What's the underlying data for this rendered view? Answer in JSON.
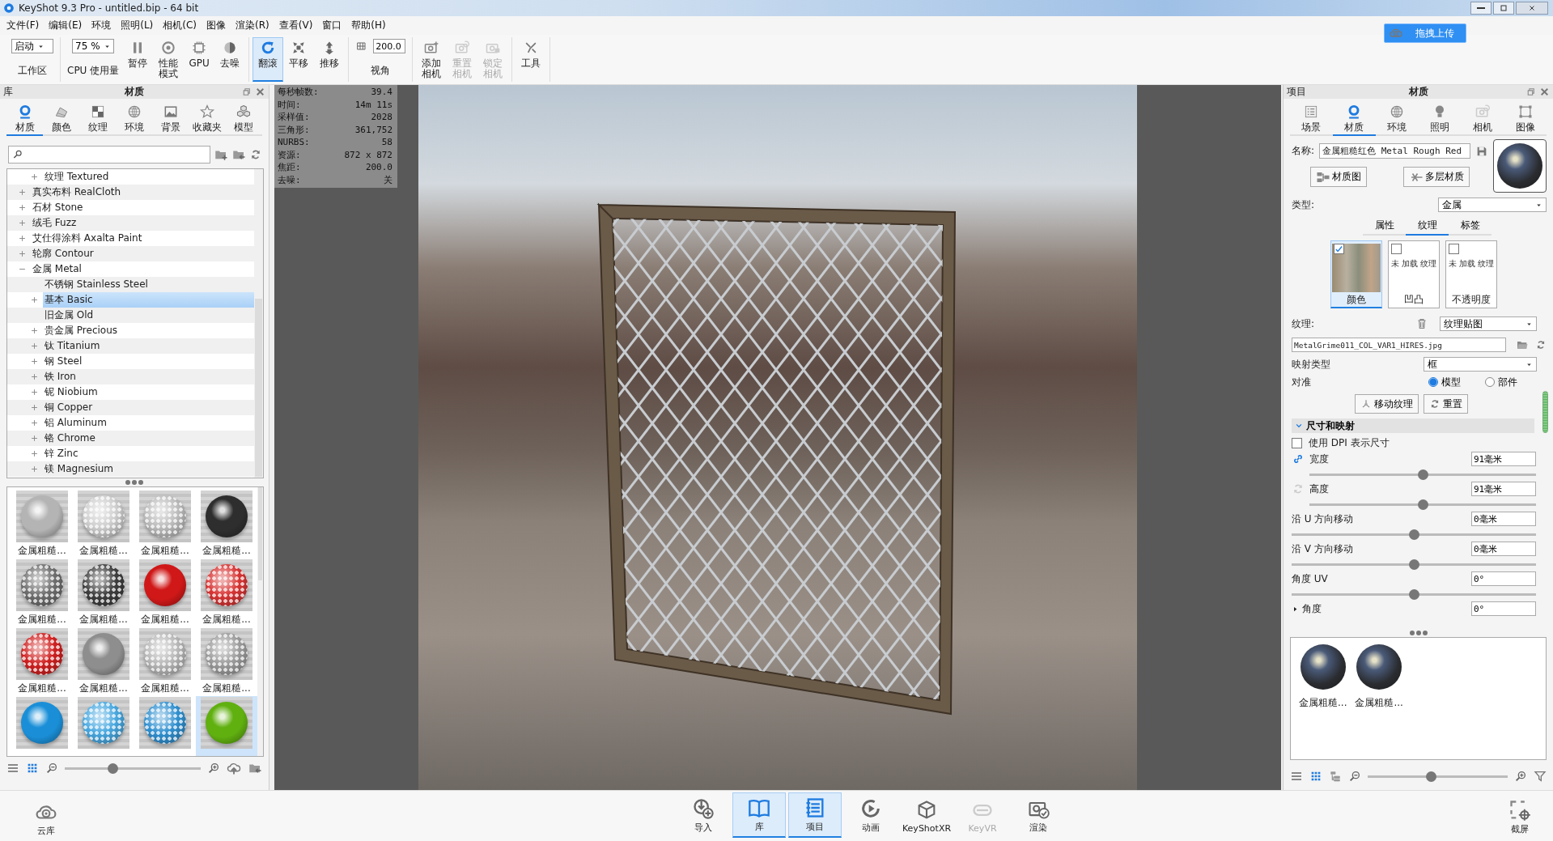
{
  "window": {
    "title": "KeyShot 9.3 Pro  - untitled.bip  - 64 bit"
  },
  "upload_button": "拖拽上传",
  "menu": [
    "文件(F)",
    "编辑(E)",
    "环境",
    "照明(L)",
    "相机(C)",
    "图像",
    "渲染(R)",
    "查看(V)",
    "窗口",
    "帮助(H)"
  ],
  "toolbar": [
    {
      "kind": "dropdown",
      "value": "启动",
      "label": "工作区"
    },
    {
      "kind": "dropdown",
      "value": "75 %",
      "label": "CPU 使用量"
    },
    {
      "kind": "button",
      "lines": [
        "暂停"
      ],
      "selected": false,
      "disabled": false
    },
    {
      "kind": "button",
      "lines": [
        "性能",
        "模式"
      ],
      "selected": false,
      "disabled": false
    },
    {
      "kind": "button",
      "lines": [
        "GPU"
      ],
      "selected": false,
      "disabled": false
    },
    {
      "kind": "button",
      "lines": [
        "去噪"
      ],
      "selected": false,
      "disabled": false
    },
    {
      "kind": "button",
      "lines": [
        "翻滚"
      ],
      "selected": true,
      "disabled": false
    },
    {
      "kind": "button",
      "lines": [
        "平移"
      ],
      "selected": false,
      "disabled": false
    },
    {
      "kind": "button",
      "lines": [
        "推移"
      ],
      "selected": false,
      "disabled": false
    },
    {
      "kind": "field",
      "value": "200.0",
      "label": "视角"
    },
    {
      "kind": "button",
      "lines": [
        "添加",
        "相机"
      ],
      "selected": false,
      "disabled": false
    },
    {
      "kind": "button",
      "lines": [
        "重置",
        "相机"
      ],
      "selected": false,
      "disabled": true
    },
    {
      "kind": "button",
      "lines": [
        "锁定",
        "相机"
      ],
      "selected": false,
      "disabled": true
    },
    {
      "kind": "button",
      "lines": [
        "工具"
      ],
      "selected": false,
      "disabled": false
    }
  ],
  "library": {
    "header": "库",
    "title": "材质",
    "tabs": [
      {
        "label": "材质",
        "selected": true
      },
      {
        "label": "颜色",
        "selected": false
      },
      {
        "label": "纹理",
        "selected": false
      },
      {
        "label": "环境",
        "selected": false
      },
      {
        "label": "背景",
        "selected": false
      },
      {
        "label": "收藏夹",
        "selected": false
      },
      {
        "label": "模型",
        "selected": false
      }
    ],
    "tree": [
      {
        "kind": "group",
        "children": [
          {
            "kind": "group",
            "label": "纹理 Textured",
            "expanded": false,
            "selected": false
          }
        ]
      },
      {
        "kind": "group",
        "label": "真实布料 RealCloth",
        "expanded": false,
        "selected": false
      },
      {
        "kind": "group",
        "label": "石材 Stone",
        "expanded": false,
        "selected": false
      },
      {
        "kind": "group",
        "label": "绒毛 Fuzz",
        "expanded": false,
        "selected": false
      },
      {
        "kind": "group",
        "label": "艾仕得涂料 Axalta Paint",
        "expanded": false,
        "selected": false
      },
      {
        "kind": "group",
        "label": "轮廓 Contour",
        "expanded": false,
        "selected": false
      },
      {
        "kind": "group",
        "label": "金属 Metal",
        "expanded": true,
        "selected": false,
        "children": [
          {
            "kind": "leaf",
            "label": "不锈钢 Stainless Steel",
            "selected": false
          },
          {
            "kind": "group",
            "label": "基本 Basic",
            "expanded": false,
            "selected": true
          },
          {
            "kind": "leaf",
            "label": "旧金属 Old",
            "selected": false
          },
          {
            "kind": "group",
            "label": "贵金属 Precious",
            "expanded": false,
            "selected": false
          },
          {
            "kind": "group",
            "label": "钛 Titanium",
            "expanded": false,
            "selected": false
          },
          {
            "kind": "group",
            "label": "钢 Steel",
            "expanded": false,
            "selected": false
          },
          {
            "kind": "group",
            "label": "铁 Iron",
            "expanded": false,
            "selected": false
          },
          {
            "kind": "group",
            "label": "铌 Niobium",
            "expanded": false,
            "selected": false
          },
          {
            "kind": "group",
            "label": "铜 Copper",
            "expanded": false,
            "selected": false
          },
          {
            "kind": "group",
            "label": "铝 Aluminum",
            "expanded": false,
            "selected": false
          },
          {
            "kind": "group",
            "label": "铬 Chrome",
            "expanded": false,
            "selected": false
          },
          {
            "kind": "group",
            "label": "锌 Zinc",
            "expanded": false,
            "selected": false
          },
          {
            "kind": "group",
            "label": "镁 Magnesium",
            "expanded": false,
            "selected": false
          }
        ]
      }
    ],
    "thumbnails": [
      {
        "label": "金属粗糙...",
        "kind": "solid",
        "color": "#b4b4b4",
        "selected": false
      },
      {
        "label": "金属粗糙...",
        "kind": "perforated",
        "color": "#cfcfcf",
        "selected": false
      },
      {
        "label": "金属粗糙...",
        "kind": "perforated",
        "color": "#bdbdbd",
        "selected": false
      },
      {
        "label": "金属粗糙...",
        "kind": "solid",
        "color": "#2e2e2e",
        "selected": false
      },
      {
        "label": "金属粗糙...",
        "kind": "perforated",
        "color": "#6e6e6e",
        "selected": false
      },
      {
        "label": "金属粗糙...",
        "kind": "perforated",
        "color": "#3e3e3e",
        "selected": false
      },
      {
        "label": "金属粗糙...",
        "kind": "solid",
        "color": "#d01818",
        "selected": false
      },
      {
        "label": "金属粗糙...",
        "kind": "perforated",
        "color": "#d83434",
        "selected": false
      },
      {
        "label": "金属粗糙...",
        "kind": "perforated",
        "color": "#d02020",
        "selected": false
      },
      {
        "label": "金属粗糙...",
        "kind": "solid",
        "color": "#8e8e8e",
        "selected": false
      },
      {
        "label": "金属粗糙...",
        "kind": "perforated",
        "color": "#b8b8b8",
        "selected": false
      },
      {
        "label": "金属粗糙...",
        "kind": "perforated",
        "color": "#9c9c9c",
        "selected": false
      },
      {
        "kind": "solid",
        "color": "#1a8fd8",
        "selected": false
      },
      {
        "kind": "perforated",
        "color": "#48a8e0",
        "selected": false
      },
      {
        "kind": "perforated",
        "color": "#3090d0",
        "selected": false
      },
      {
        "kind": "solid",
        "color": "#60b010",
        "selected": true
      }
    ],
    "zoom": {
      "level": 0.35
    }
  },
  "stats": [
    {
      "label": "每秒帧数:",
      "value": "39.4"
    },
    {
      "label": "时间:",
      "value": "14m 11s"
    },
    {
      "label": "采样值:",
      "value": "2028"
    },
    {
      "label": "三角形:",
      "value": "361,752"
    },
    {
      "label": "NURBS:",
      "value": "58"
    },
    {
      "label": "资源:",
      "value": "872 x 872"
    },
    {
      "label": "焦距:",
      "value": "200.0"
    },
    {
      "label": "去噪:",
      "value": "关"
    }
  ],
  "project": {
    "header": "项目",
    "title": "材质",
    "tabs": [
      {
        "label": "场景",
        "selected": false
      },
      {
        "label": "材质",
        "selected": true
      },
      {
        "label": "环境",
        "selected": false
      },
      {
        "label": "照明",
        "selected": false
      },
      {
        "label": "相机",
        "selected": false
      },
      {
        "label": "图像",
        "selected": false
      }
    ],
    "name_label": "名称:",
    "name_value": "金属粗糙红色 Metal Rough Red",
    "graph_buttons": [
      "材质图",
      "多层材质"
    ],
    "type_label": "类型:",
    "type_value": "金属",
    "subtabs": [
      {
        "label": "属性",
        "selected": false
      },
      {
        "label": "纹理",
        "selected": true
      },
      {
        "label": "标签",
        "selected": false
      }
    ],
    "slots": [
      {
        "kind": "image",
        "label": "颜色",
        "checked": true,
        "selected": true
      },
      {
        "kind": "empty",
        "empty_text": "未 加载 纹理",
        "label": "凹凸",
        "checked": false,
        "selected": false
      },
      {
        "kind": "empty",
        "empty_text": "未 加载 纹理",
        "label": "不透明度",
        "checked": false,
        "selected": false
      }
    ],
    "texture_label": "纹理:",
    "texture_value": "纹理贴图",
    "file": "MetalGrime011_COL_VAR1_HIRES.jpg",
    "mapping_label": "映射类型",
    "mapping_value": "框",
    "align_label": "对准",
    "align_options": [
      {
        "label": "模型",
        "selected": true
      },
      {
        "label": "部件",
        "selected": false
      }
    ],
    "action_buttons": [
      "移动纹理",
      "重置"
    ],
    "section": {
      "title": "尺寸和映射",
      "expanded": true
    },
    "dpi": {
      "label": "使用 DPI 表示尺寸",
      "checked": false
    },
    "params": [
      {
        "kind": "link",
        "label": "宽度",
        "value": "91毫米",
        "level": 0.5
      },
      {
        "kind": "sync",
        "label": "高度",
        "value": "91毫米",
        "level": 0.5
      },
      {
        "kind": "plain",
        "label": "沿 U 方向移动",
        "value": "0毫米",
        "level": 0.5
      },
      {
        "kind": "plain",
        "label": "沿 V 方向移动",
        "value": "0毫米",
        "level": 0.5
      },
      {
        "kind": "plain",
        "label": "角度 UV",
        "value": "0°",
        "level": 0.5
      }
    ],
    "collapsed_param": {
      "label": "角度",
      "value": "0°",
      "expanded": false
    },
    "materials": [
      "金属粗糙...",
      "金属粗糙..."
    ],
    "zoom": {
      "level": 0.45
    }
  },
  "bottom": {
    "left": "云库",
    "center": [
      {
        "label": "导入",
        "selected": false,
        "disabled": false
      },
      {
        "label": "库",
        "selected": true,
        "disabled": false
      },
      {
        "label": "项目",
        "selected": true,
        "disabled": false
      },
      {
        "label": "动画",
        "selected": false,
        "disabled": false
      },
      {
        "label": "KeyShotXR",
        "selected": false,
        "disabled": false
      },
      {
        "label": "KeyVR",
        "selected": false,
        "disabled": true
      },
      {
        "label": "渲染",
        "selected": false,
        "disabled": false
      }
    ],
    "right": "截屏"
  }
}
